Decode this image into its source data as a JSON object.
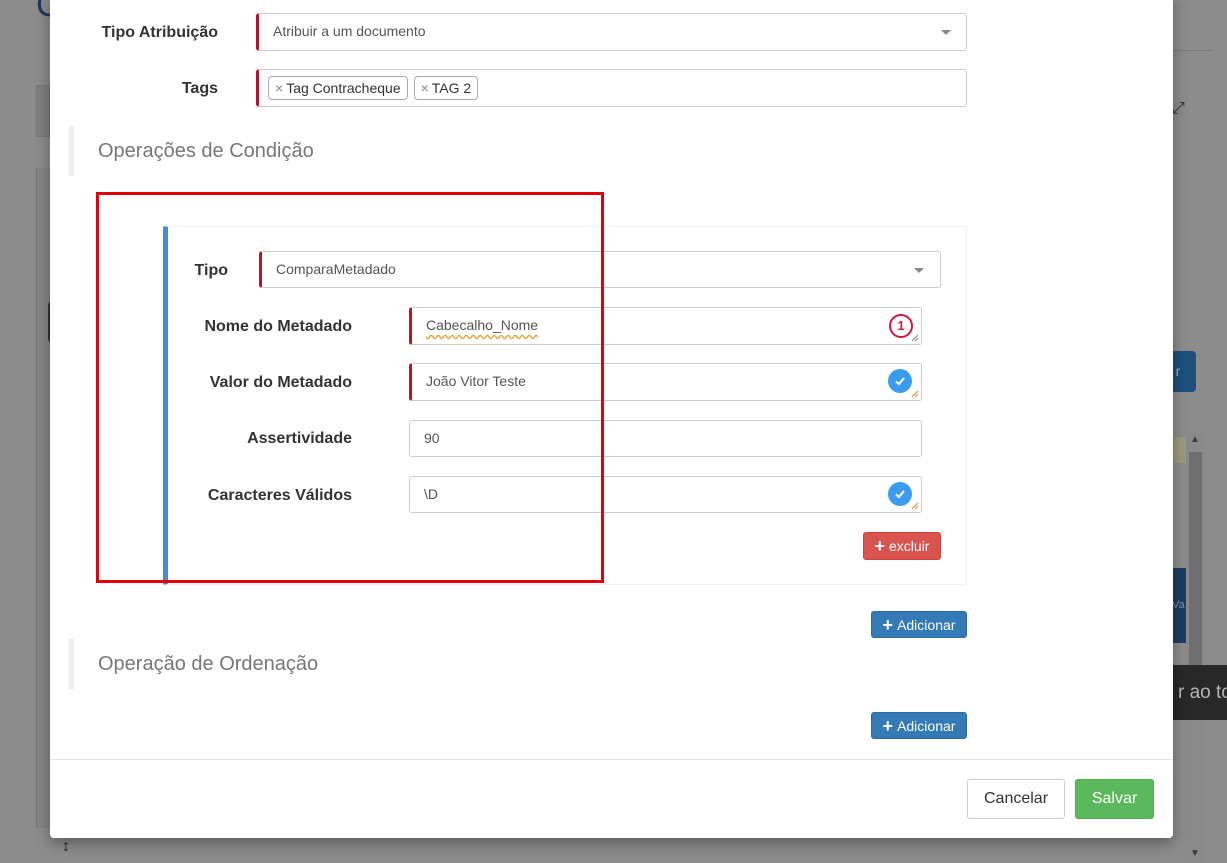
{
  "background": {
    "partial_button_text": "r",
    "partial_blue_text": "Va",
    "partial_tooltip_text": "r ao to"
  },
  "form": {
    "tipo_atribuicao": {
      "label": "Tipo Atribuição",
      "value": "Atribuir a um documento"
    },
    "tags": {
      "label": "Tags",
      "items": [
        "Tag Contracheque",
        "TAG 2"
      ],
      "remove_glyph": "×"
    }
  },
  "condition_section": {
    "title": "Operações de Condição",
    "operation": {
      "tipo": {
        "label": "Tipo",
        "value": "ComparaMetadado"
      },
      "nome_metadado": {
        "label": "Nome do Metadado",
        "value": "Cabecalho_Nome",
        "status_icon": "error-count-icon",
        "status_count": "1"
      },
      "valor_metadado": {
        "label": "Valor do Metadado",
        "value": "João Vitor Teste",
        "status_icon": "check-icon"
      },
      "assertividade": {
        "label": "Assertividade",
        "value": "90"
      },
      "caracteres_validos": {
        "label": "Caracteres Válidos",
        "value": "\\D",
        "status_icon": "check-icon"
      },
      "delete_label": "excluir"
    },
    "add_label": "Adicionar"
  },
  "ordering_section": {
    "title": "Operação de Ordenação",
    "add_label": "Adicionar"
  },
  "footer": {
    "cancel_label": "Cancelar",
    "save_label": "Salvar"
  },
  "colors": {
    "required_marker": "#b9122b",
    "panel_accent": "#3d8fd0",
    "highlight_box": "#e3000b",
    "danger": "#d9534f",
    "primary": "#337ab7",
    "success": "#5cb85c"
  }
}
